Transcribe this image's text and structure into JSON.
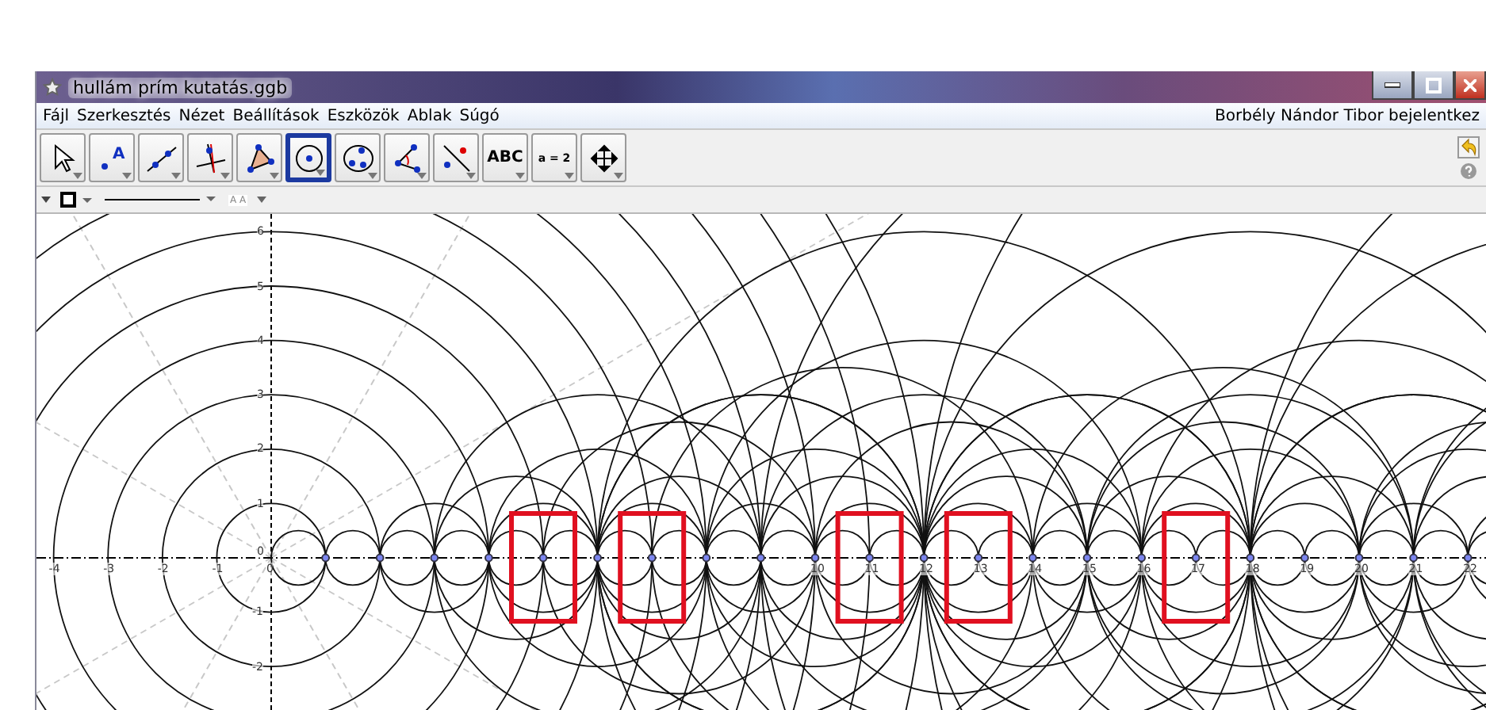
{
  "window": {
    "title": "hullám prím kutatás.ggb"
  },
  "menu": [
    "Fájl",
    "Szerkesztés",
    "Nézet",
    "Beállítások",
    "Eszközök",
    "Ablak",
    "Súgó"
  ],
  "user_label": "Borbély Nándor Tibor bejelentkez",
  "toolbar": [
    {
      "kind": "pointer",
      "selected": false
    },
    {
      "kind": "point",
      "selected": false,
      "icon_text": "A"
    },
    {
      "kind": "line",
      "selected": false
    },
    {
      "kind": "perpendicular",
      "selected": false
    },
    {
      "kind": "polygon",
      "selected": false
    },
    {
      "kind": "circle",
      "selected": true
    },
    {
      "kind": "conic",
      "selected": false
    },
    {
      "kind": "angle",
      "selected": false
    },
    {
      "kind": "reflect",
      "selected": false
    },
    {
      "kind": "text",
      "selected": false,
      "label": "ABC"
    },
    {
      "kind": "slider",
      "selected": false,
      "label": "a = 2"
    },
    {
      "kind": "move-view",
      "selected": false
    }
  ],
  "style_bar": {
    "font_size_label": "A A"
  },
  "graphics": {
    "x_labels": [
      "-4",
      "-3",
      "-2",
      "-1",
      "0",
      "10",
      "11",
      "12",
      "13",
      "14",
      "15",
      "16",
      "17",
      "18",
      "19",
      "20",
      "21",
      "22"
    ],
    "y_labels": [
      "6",
      "5",
      "4",
      "3",
      "2",
      "1",
      "0",
      "-1",
      "-2"
    ]
  }
}
